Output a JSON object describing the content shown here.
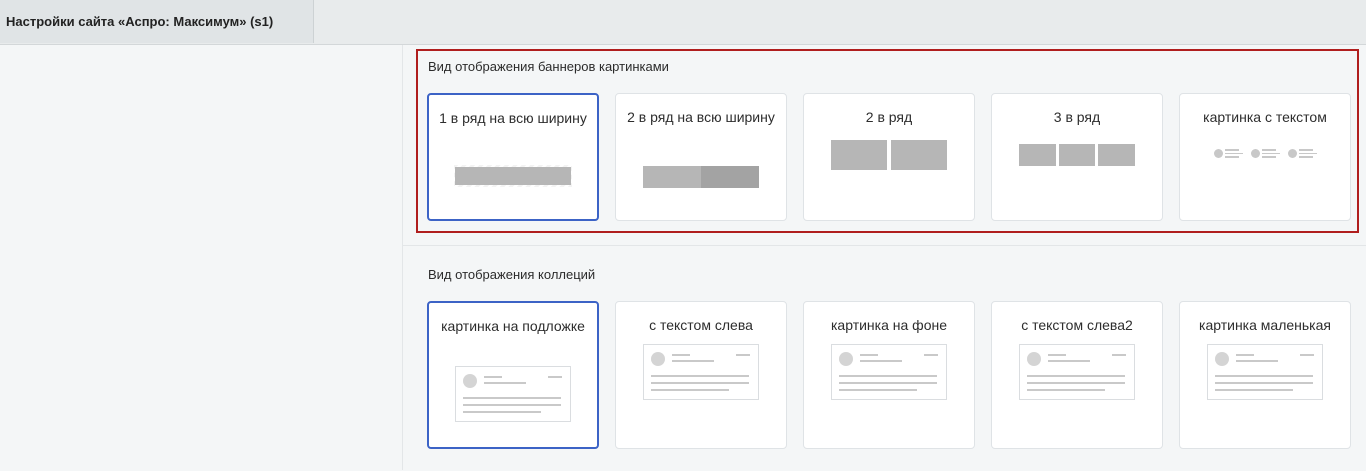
{
  "tab": {
    "title": "Настройки сайта «Аспро: Максимум» (s1)"
  },
  "banners": {
    "title": "Вид отображения баннеров картинками",
    "options": [
      {
        "label": "1 в ряд на всю ширину",
        "selected": true
      },
      {
        "label": "2 в ряд на всю ширину",
        "selected": false
      },
      {
        "label": "2 в ряд",
        "selected": false
      },
      {
        "label": "3 в ряд",
        "selected": false
      },
      {
        "label": "картинка с текстом",
        "selected": false
      }
    ]
  },
  "collections": {
    "title": "Вид отображения коллеций",
    "options": [
      {
        "label": "картинка на подложке",
        "selected": true
      },
      {
        "label": "с текстом слева",
        "selected": false
      },
      {
        "label": "картинка на фоне",
        "selected": false
      },
      {
        "label": "с текстом слева2",
        "selected": false
      },
      {
        "label": "картинка маленькая",
        "selected": false
      }
    ]
  },
  "colors": {
    "selected_border": "#3c63c6",
    "highlight_border": "#b01e1e"
  }
}
